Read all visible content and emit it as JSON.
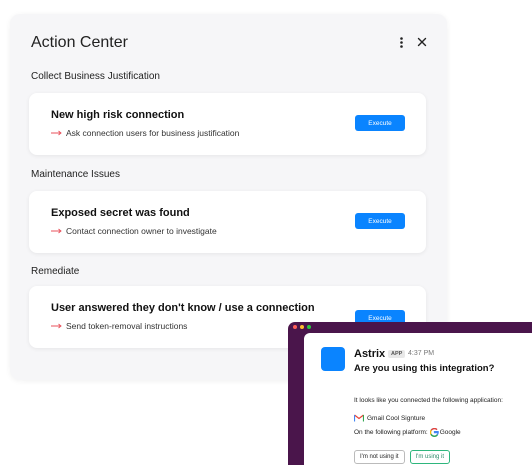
{
  "panel": {
    "title": "Action Center",
    "menu_icon": "more-vertical-icon",
    "close_icon": "close-icon"
  },
  "sections": [
    {
      "label": "Collect Business Justification",
      "card": {
        "title": "New high risk connection",
        "subtitle": "Ask connection users for business justification",
        "button": "Execute"
      }
    },
    {
      "label": "Maintenance Issues",
      "card": {
        "title": "Exposed secret was found",
        "subtitle": "Contact connection owner to investigate",
        "button": "Execute"
      }
    },
    {
      "label": "Remediate",
      "card": {
        "title": "User answered they don't know / use a connection",
        "subtitle": "Send token-removal instructions",
        "button": "Execute"
      }
    }
  ],
  "slack": {
    "app_name": "Astrix",
    "badge": "APP",
    "time": "4:37 PM",
    "question": "Are you using this integration?",
    "line1": "It looks like you connected the following application:",
    "app_item": "Gmail Cool Signture",
    "platform_label": "On the following platform:",
    "platform": "Google",
    "btn_no": "I'm not using it",
    "btn_yes": "I'm using it"
  },
  "colors": {
    "accent": "#0a84ff",
    "arrow": "#e8505b",
    "slack_bg": "#4a154b",
    "slack_green": "#2eb67d"
  }
}
